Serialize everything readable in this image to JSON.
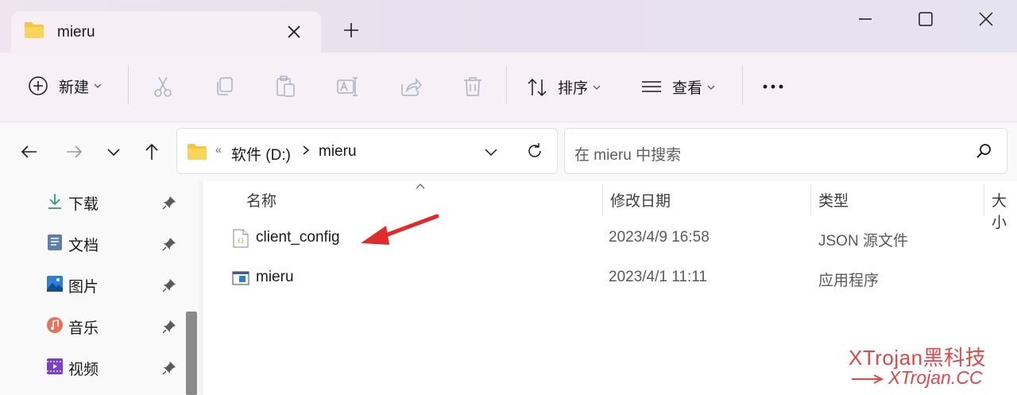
{
  "window": {
    "tab_title": "mieru",
    "new_tab_glyph": "+"
  },
  "toolbar": {
    "new_label": "新建",
    "sort_label": "排序",
    "view_label": "查看",
    "more_glyph": "•••",
    "icons": [
      "cut-icon",
      "copy-icon",
      "paste-icon",
      "rename-icon",
      "share-icon",
      "delete-icon"
    ]
  },
  "address": {
    "overflow_glyph": "«",
    "crumbs": [
      "软件 (D:)",
      "mieru"
    ]
  },
  "search": {
    "placeholder": "在 mieru 中搜索"
  },
  "sidebar": {
    "items": [
      {
        "label": "下载",
        "icon": "download-icon"
      },
      {
        "label": "文档",
        "icon": "document-icon"
      },
      {
        "label": "图片",
        "icon": "pictures-icon"
      },
      {
        "label": "音乐",
        "icon": "music-icon"
      },
      {
        "label": "视频",
        "icon": "videos-icon"
      }
    ]
  },
  "columns": {
    "name": "名称",
    "modified": "修改日期",
    "type": "类型",
    "size": "大小"
  },
  "files": [
    {
      "name": "client_config",
      "modified": "2023/4/9 16:58",
      "type": "JSON 源文件",
      "icon": "json-file-icon"
    },
    {
      "name": "mieru",
      "modified": "2023/4/1 11:11",
      "type": "应用程序",
      "icon": "application-icon"
    }
  ],
  "watermark": {
    "line1": "XTrojan黑科技",
    "line2": "XTrojan.CC"
  },
  "colors": {
    "accent_red": "#e54646",
    "folder_yellow": "#f4c542"
  }
}
